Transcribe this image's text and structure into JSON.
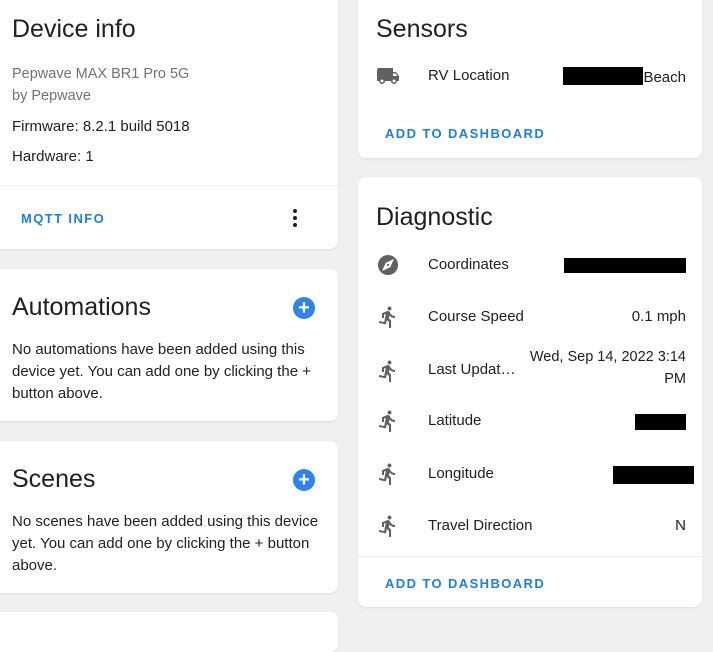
{
  "device_info": {
    "title": "Device info",
    "model": "Pepwave MAX BR1 Pro 5G",
    "manufacturer": "by Pepwave",
    "firmware": "Firmware: 8.2.1 build 5018",
    "hardware": "Hardware: 1",
    "mqtt_label": "MQTT INFO"
  },
  "automations": {
    "title": "Automations",
    "empty_text": "No automations have been added using this device yet. You can add one by clicking the + button above."
  },
  "scenes": {
    "title": "Scenes",
    "empty_text": "No scenes have been added using this device yet. You can add one by clicking the + button above."
  },
  "sensors": {
    "title": "Sensors",
    "rows": [
      {
        "icon": "truck-icon",
        "label": "RV Location",
        "value": "Beach"
      }
    ],
    "add_label": "ADD TO DASHBOARD"
  },
  "diagnostic": {
    "title": "Diagnostic",
    "rows": [
      {
        "icon": "compass-icon",
        "label": "Coordinates",
        "value": ""
      },
      {
        "icon": "run-icon",
        "label": "Course Speed",
        "value": "0.1 mph"
      },
      {
        "icon": "run-icon",
        "label": "Last Updat…",
        "value_line1": "Wed, Sep 14, 2022 3:14",
        "value_line2": "PM"
      },
      {
        "icon": "run-icon",
        "label": "Latitude",
        "value": ""
      },
      {
        "icon": "run-icon",
        "label": "Longitude",
        "value": ""
      },
      {
        "icon": "run-icon",
        "label": "Travel Direction",
        "value": "N"
      }
    ],
    "add_label": "ADD TO DASHBOARD"
  },
  "colors": {
    "accent": "#1e7fd6",
    "plus_button": "#2f85e3",
    "background": "#f0f0f0",
    "icon": "#616161"
  }
}
